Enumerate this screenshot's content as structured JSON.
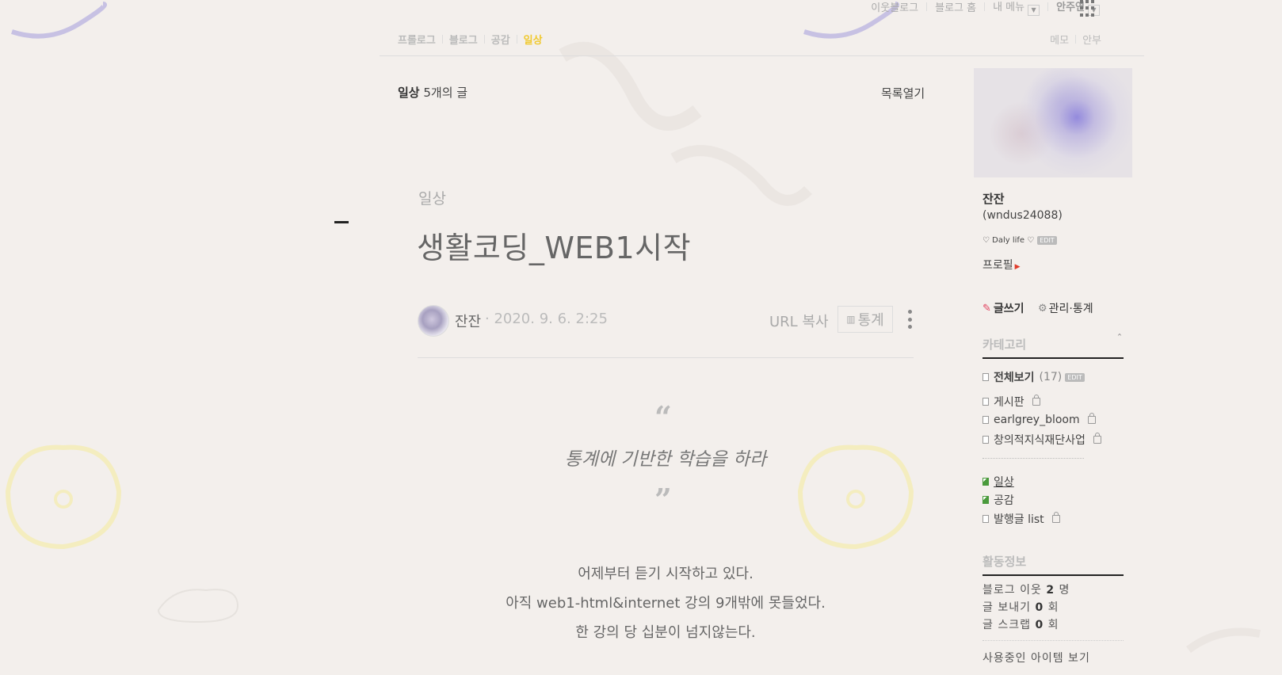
{
  "topbar": {
    "neighbor_blog": "이웃블로그",
    "blog_home": "블로그 홈",
    "my_menu": "내 메뉴",
    "user_name": "안주연"
  },
  "menu": {
    "items": [
      "프롤로그",
      "블로그",
      "공감",
      "일상"
    ],
    "active": "일상",
    "memo": "메모",
    "guestbook": "안부"
  },
  "post_list": {
    "category_name": "일상",
    "count_text": "5개의 글",
    "open_list": "목록열기"
  },
  "post": {
    "category": "일상",
    "title": "생활코딩_WEB1시작",
    "author": "잔잔",
    "date": "· 2020. 9. 6. 2:25",
    "url_copy": "URL 복사",
    "stats": "통계",
    "quote_open": "“",
    "quote": "통계에 기반한 학습을 하라",
    "quote_close": "”",
    "body": [
      "어제부터 듣기 시작하고 있다.",
      "아직 web1-html&internet 강의 9개밖에 못들었다.",
      "한 강의 당 십분이 넘지않는다."
    ]
  },
  "profile": {
    "name": "잔잔",
    "id": "(wndus24088)",
    "desc": "♡ Daly life ♡",
    "edit": "EDIT",
    "profile_link": "프로필"
  },
  "actions": {
    "write": "글쓰기",
    "manage": "관리·통계"
  },
  "categories": {
    "header": "카테고리",
    "all": "전체보기",
    "all_count": "(17)",
    "edit": "EDIT",
    "items": [
      {
        "label": "게시판",
        "locked": true
      },
      {
        "label": "earlgrey_bloom",
        "locked": true
      },
      {
        "label": "창의적지식재단사업",
        "locked": true
      },
      {
        "label": "일상",
        "locked": false
      },
      {
        "label": "공감",
        "locked": false
      },
      {
        "label": "발행글 list",
        "locked": true
      }
    ]
  },
  "activity": {
    "header": "활동정보",
    "neighbors_label": "블로그 이웃",
    "neighbors_value": "2",
    "neighbors_unit": "명",
    "sent_label": "글 보내기",
    "sent_value": "0",
    "sent_unit": "회",
    "scrap_label": "글 스크랩",
    "scrap_value": "0",
    "scrap_unit": "회",
    "items_link": "사용중인 아이템 보기"
  }
}
